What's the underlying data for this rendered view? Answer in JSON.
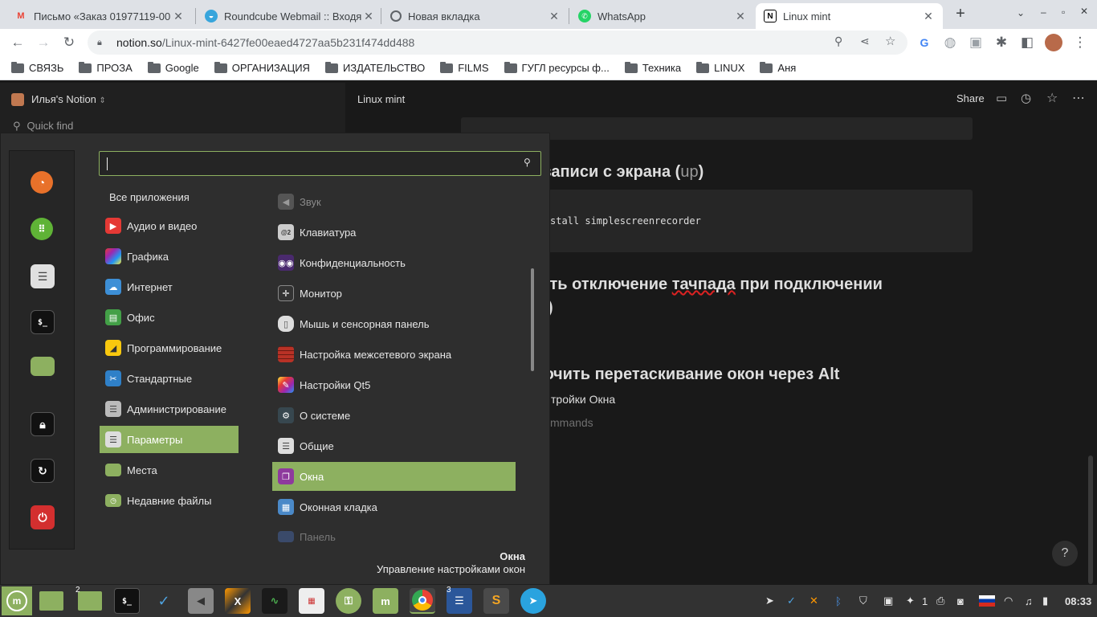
{
  "browser": {
    "tabs": [
      {
        "title": "Письмо «Заказ 01977119-00",
        "icon": "gmail-icon",
        "active": false
      },
      {
        "title": "Roundcube Webmail :: Входя",
        "icon": "roundcube-icon",
        "active": false
      },
      {
        "title": "Новая вкладка",
        "icon": "chrome-icon",
        "active": false
      },
      {
        "title": "WhatsApp",
        "icon": "whatsapp-icon",
        "active": false
      },
      {
        "title": "Linux mint",
        "icon": "notion-icon",
        "active": true
      }
    ],
    "url_host": "notion.so",
    "url_path": "/Linux-mint-6427fe00eaed4727aa5b231f474dd488",
    "bookmarks": [
      "СВЯЗЬ",
      "ПРОЗА",
      "Google",
      "ОРГАНИЗАЦИЯ",
      "ИЗДАТЕЛЬСТВО",
      "FILMS",
      "ГУГЛ ресурсы ф...",
      "Техника",
      "LINUX",
      "Аня"
    ]
  },
  "notion": {
    "workspace": "Илья's Notion",
    "quick_find": "Quick find",
    "page_title": "Linux mint",
    "share": "Share",
    "heading1": "а записи с экрана (",
    "heading1_link": "up",
    "heading1_end": ")",
    "code": "stall simplescreenrecorder",
    "heading2_a": "рить отключение ",
    "heading2_b": "тачпада",
    "heading2_c": " при подключении",
    "heading2_line2": ")",
    "heading3": "лючить перетаскивание окон через Alt",
    "text1": "тройки Окна",
    "text2": "mmands",
    "help": "?"
  },
  "menu": {
    "search_value": "",
    "all_apps": "Все приложения",
    "categories": [
      {
        "label": "Аудио и видео",
        "icon": "play-icon",
        "color": "#e53935"
      },
      {
        "label": "Графика",
        "icon": "graphics-icon",
        "color": "#9c27b0"
      },
      {
        "label": "Интернет",
        "icon": "cloud-icon",
        "color": "#3d8fd6"
      },
      {
        "label": "Офис",
        "icon": "office-icon",
        "color": "#43a047"
      },
      {
        "label": "Программирование",
        "icon": "programming-icon",
        "color": "#f9c80e"
      },
      {
        "label": "Стандартные",
        "icon": "scissors-icon",
        "color": "#2f80c8"
      },
      {
        "label": "Администрирование",
        "icon": "toggles-icon",
        "color": "#bbbbbb"
      },
      {
        "label": "Параметры",
        "icon": "settings-icon",
        "color": "#dddddd"
      },
      {
        "label": "Места",
        "icon": "folder-icon",
        "color": "#8db060"
      },
      {
        "label": "Недавние файлы",
        "icon": "recent-folder-icon",
        "color": "#8db060"
      }
    ],
    "items": [
      {
        "label": "Звук",
        "icon": "speaker-icon",
        "color": "#777777",
        "dim": true
      },
      {
        "label": "Клавиатура",
        "icon": "keyboard-icon",
        "color": "#cccccc",
        "dim": false
      },
      {
        "label": "Конфиденциальность",
        "icon": "mask-icon",
        "color": "#6a3a8e",
        "dim": false
      },
      {
        "label": "Монитор",
        "icon": "monitor-icon",
        "color": "#333333",
        "dim": false
      },
      {
        "label": "Мышь и сенсорная панель",
        "icon": "mouse-icon",
        "color": "#dddddd",
        "dim": false
      },
      {
        "label": "Настройка межсетевого экрана",
        "icon": "firewall-icon",
        "color": "#b83226",
        "dim": false
      },
      {
        "label": "Настройки Qt5",
        "icon": "qt-icon",
        "color": "#7cb342",
        "dim": false
      },
      {
        "label": "О системе",
        "icon": "gear-icon",
        "color": "#37474f",
        "dim": false
      },
      {
        "label": "Общие",
        "icon": "toggles-icon",
        "color": "#dddddd",
        "dim": false
      },
      {
        "label": "Окна",
        "icon": "windows-icon",
        "color": "#8e3a9d",
        "dim": false
      },
      {
        "label": "Оконная кладка",
        "icon": "tiling-icon",
        "color": "#4a89c8",
        "dim": false
      },
      {
        "label": "Панель",
        "icon": "panel-icon",
        "color": "#3a4a6a",
        "dim": true
      }
    ],
    "footer_title": "Окна",
    "footer_desc": "Управление настройками окон"
  },
  "taskbar": {
    "badge_files": "2",
    "badge_writer": "3",
    "tray_count": "1",
    "clock": "08:33"
  }
}
